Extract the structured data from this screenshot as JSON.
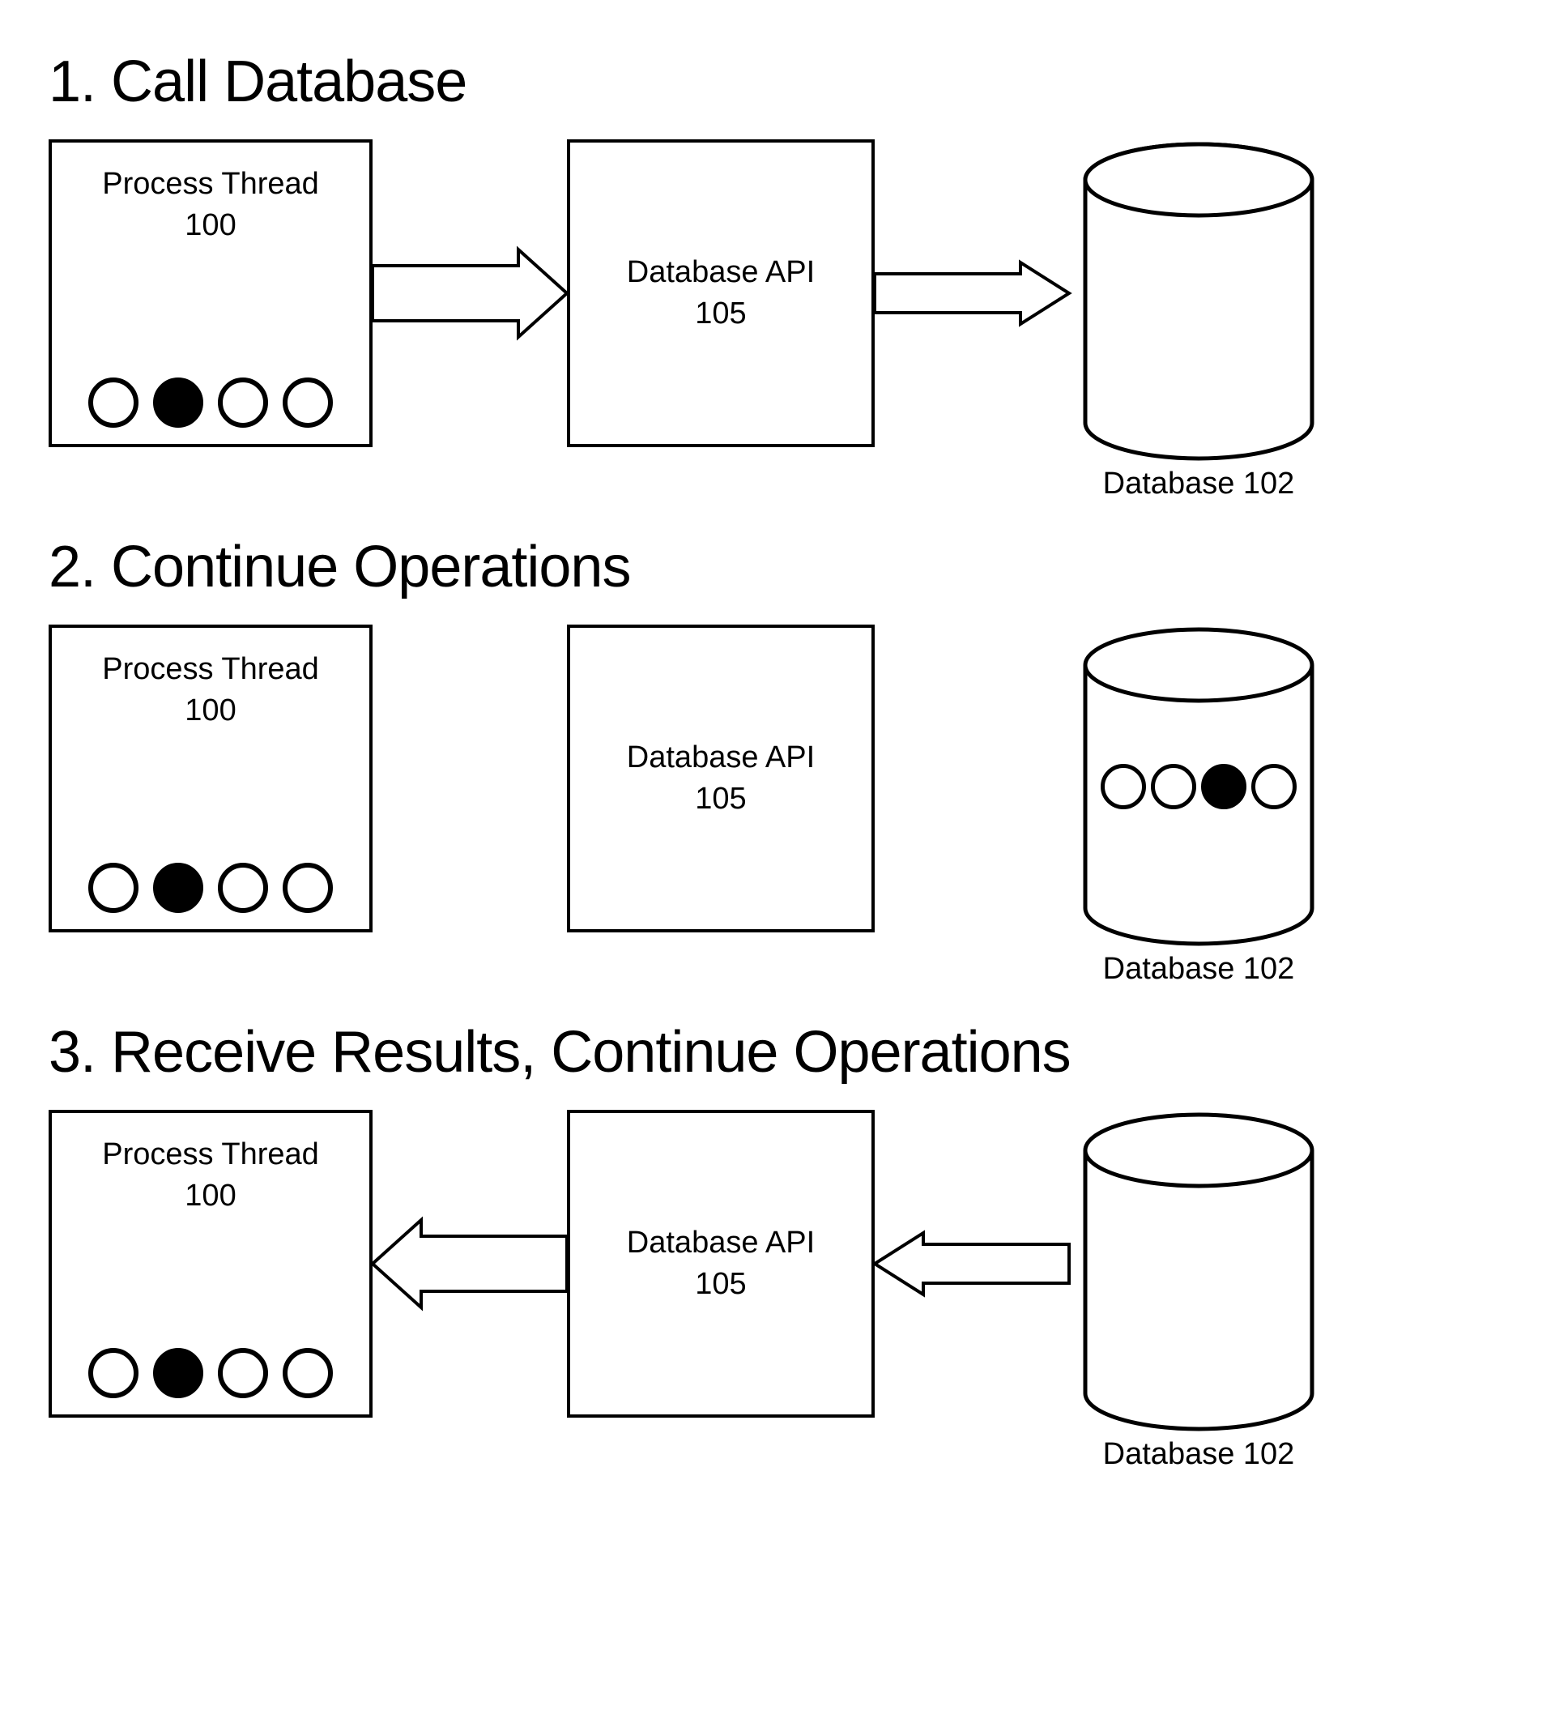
{
  "sections": {
    "s1": {
      "title": "1. Call Database"
    },
    "s2": {
      "title": "2. Continue Operations"
    },
    "s3": {
      "title": "3. Receive Results, Continue Operations"
    }
  },
  "process": {
    "name": "Process Thread",
    "id": "100",
    "full": "Process Thread\n100"
  },
  "api": {
    "name": "Database API",
    "id": "105",
    "full": "Database API\n105"
  },
  "database": {
    "name": "Database",
    "id": "102",
    "full": "Database 102"
  },
  "process_circle_states": [
    "empty",
    "filled",
    "empty",
    "empty"
  ],
  "db_circle_states": [
    "empty",
    "empty",
    "filled",
    "empty"
  ]
}
